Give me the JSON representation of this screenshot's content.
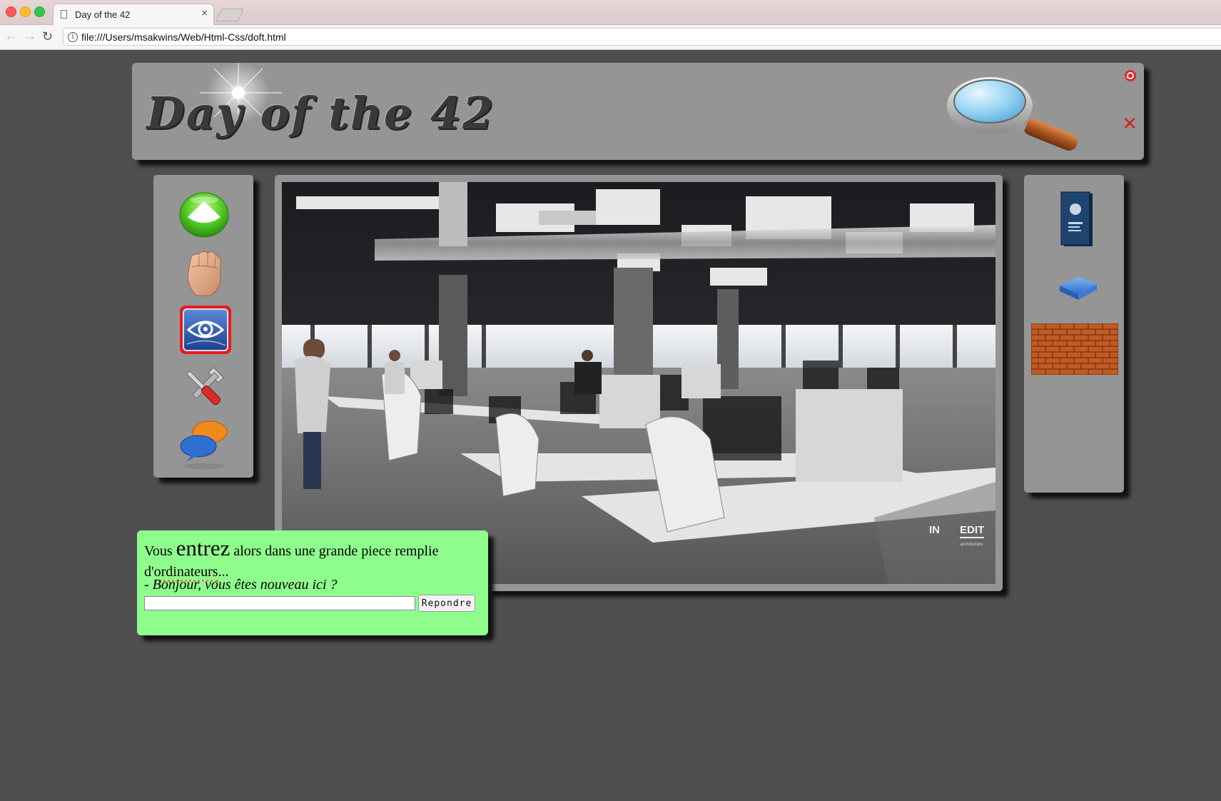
{
  "browser": {
    "tab_title": "Day of the 42",
    "tab_close": "×",
    "url": "file:///Users/msakwins/Web/Html-Css/doft.html",
    "info_glyph": "i",
    "back_glyph": "←",
    "forward_glyph": "→",
    "reload_glyph": "↻"
  },
  "header": {
    "logo_text": "Day of the 42",
    "close_glyph": "✕",
    "icons": [
      "magnifier-icon",
      "refresh-icon",
      "close-icon"
    ]
  },
  "left_sidebar": {
    "items": [
      "up-arrow-icon",
      "fist-hand-icon",
      "eye-icon",
      "tools-icon",
      "chat-bubbles-icon"
    ],
    "selected": "eye-icon"
  },
  "right_sidebar": {
    "items": [
      "book-icon",
      "towel-icon",
      "brick-wall-icon"
    ]
  },
  "scene": {
    "logo_in": "IN",
    "logo_edit": "EDIT",
    "logo_sub": "architecture"
  },
  "dialog": {
    "line_part1": "Vous",
    "line_big": "entrez",
    "line_part2": "alors dans une grande piece remplie",
    "line2_prefix": "d'",
    "line2_word": "ordinateurs",
    "line2_suffix": "...",
    "quote": "- Bonjour, vous êtes nouveau ici ?",
    "input_value": "",
    "button_label": "Repondre"
  },
  "colors": {
    "page_bg": "#4f4f4f",
    "panel_bg": "#959595",
    "dialog_bg": "#8ffe8d",
    "selected_border": "#e81b1b",
    "close_red": "#d92020"
  }
}
